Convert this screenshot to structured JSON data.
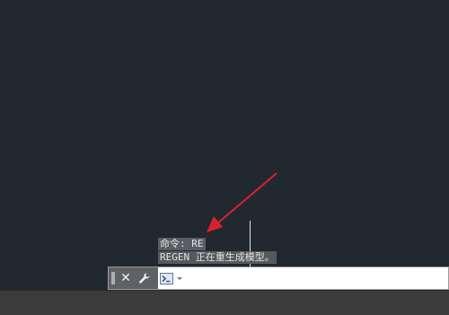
{
  "colors": {
    "canvas_bg": "#212830",
    "status_bg": "#3b3b3b",
    "annotation_arrow": "#d9232b"
  },
  "command_history": [
    "命令: RE",
    "REGEN 正在重生成模型。"
  ],
  "command_line": {
    "close_icon": "close-icon",
    "settings_icon": "wrench-icon",
    "prompt_icon": "command-prompt-icon",
    "input_value": "",
    "input_placeholder": ""
  },
  "annotation": {
    "icon": "red-arrow-icon"
  }
}
